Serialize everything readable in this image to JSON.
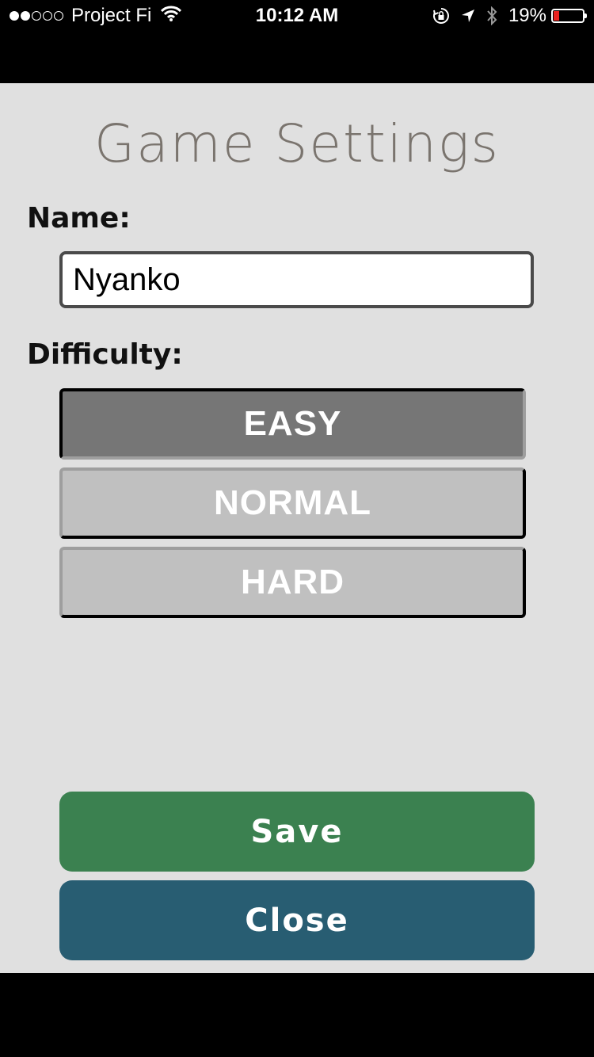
{
  "status_bar": {
    "carrier": "Project Fi",
    "time": "10:12 AM",
    "battery_percent": "19%",
    "battery_level": 0.19,
    "signal_bars_filled": 2,
    "signal_bars_total": 5,
    "icons": [
      "wifi-icon",
      "rotation-lock-icon",
      "location-arrow-icon",
      "bluetooth-icon",
      "battery-icon"
    ]
  },
  "settings": {
    "title": "Game Settings",
    "name_label": "Name:",
    "name_value": "Nyanko",
    "difficulty_label": "Difficulty:",
    "difficulties": [
      {
        "label": "EASY",
        "selected": true
      },
      {
        "label": "NORMAL",
        "selected": false
      },
      {
        "label": "HARD",
        "selected": false
      }
    ],
    "save_label": "Save",
    "close_label": "Close"
  },
  "colors": {
    "background": "#e0e0e0",
    "title": "#7a746e",
    "selected_button": "#767676",
    "unselected_button": "#c0c0c0",
    "save_button": "#3b8150",
    "close_button": "#285d72",
    "battery_low": "#e8231f"
  }
}
